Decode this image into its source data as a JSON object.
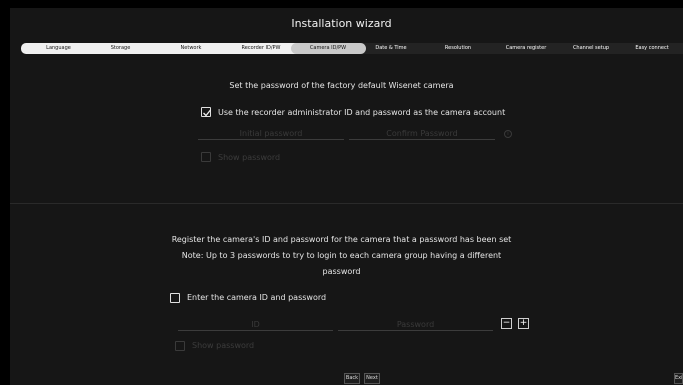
{
  "window": {
    "title": "Installation wizard"
  },
  "steps": [
    {
      "label": "Language"
    },
    {
      "label": "Storage"
    },
    {
      "label": "Network"
    },
    {
      "label": "Recorder ID/PW"
    },
    {
      "label": "Camera ID/PW",
      "active": true
    },
    {
      "label": "Date & Time"
    },
    {
      "label": "Resolution"
    },
    {
      "label": "Camera register"
    },
    {
      "label": "Channel setup"
    },
    {
      "label": "Easy connect"
    }
  ],
  "factory": {
    "heading": "Set the password of the factory default Wisenet camera",
    "use_admin_label": "Use the recorder administrator ID and password as the camera account",
    "use_admin_checked": true,
    "initial_password_placeholder": "Initial password",
    "confirm_password_placeholder": "Confirm Password",
    "show_password_label": "Show password"
  },
  "register": {
    "line1": "Register the camera's ID and password for the camera that a password has been set",
    "line2": "Note: Up to 3 passwords to try to login to each camera group having a different",
    "line3": "password",
    "enter_label": "Enter the camera ID and password",
    "enter_checked": false,
    "id_placeholder": "ID",
    "password_placeholder": "Password",
    "minus_label": "−",
    "plus_label": "+",
    "show_password_label": "Show password"
  },
  "nav": {
    "back": "Back",
    "next": "Next",
    "exit": "Exit"
  },
  "colors": {
    "background": "#161616",
    "step_bar": "#f0f0f0",
    "step_active": "#c9c9c9"
  }
}
